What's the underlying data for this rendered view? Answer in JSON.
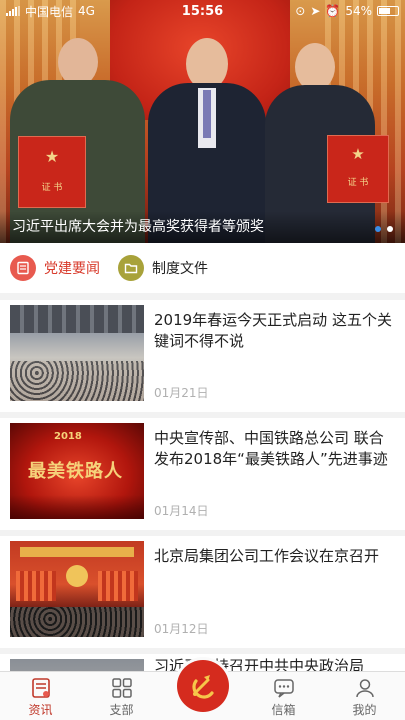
{
  "status_bar": {
    "carrier": "中国电信",
    "network": "4G",
    "time": "15:56",
    "battery": "54%"
  },
  "banner": {
    "caption": "习近平出席大会并为最高奖获得者等颁奖",
    "certificate_text": "证 书",
    "slide_count": 2,
    "active_slide": 1
  },
  "categories": [
    {
      "label": "党建要闻",
      "active": true,
      "icon": "newspaper-icon",
      "color": "#e85a4f"
    },
    {
      "label": "制度文件",
      "active": false,
      "icon": "folder-icon",
      "color": "#a8a23a"
    }
  ],
  "news": [
    {
      "title": "2019年春运今天正式启动 这五个关键词不得不说",
      "date": "01月21日",
      "thumb": "railway-station-crowd"
    },
    {
      "title": "中央宣传部、中国铁路总公司 联合发布2018年“最美铁路人”先进事迹",
      "date": "01月14日",
      "thumb": "most-beautiful-railway-people-poster",
      "thumb_text": "最美铁路人"
    },
    {
      "title": "北京局集团公司工作会议在京召开",
      "date": "01月12日",
      "thumb": "conference-hall"
    },
    {
      "title": "习近平主持召开中共中央政治局",
      "date": "",
      "thumb": "meeting"
    }
  ],
  "tabs": [
    {
      "label": "资讯",
      "icon": "news-icon",
      "active": true
    },
    {
      "label": "支部",
      "icon": "grid-icon",
      "active": false
    },
    {
      "label": "",
      "icon": "party-emblem-icon",
      "active": false
    },
    {
      "label": "信箱",
      "icon": "message-icon",
      "active": false
    },
    {
      "label": "我的",
      "icon": "user-icon",
      "active": false
    }
  ],
  "colors": {
    "accent": "#d83a2b",
    "emblem_bg": "#d52b1e",
    "date": "#b0b0b0"
  }
}
